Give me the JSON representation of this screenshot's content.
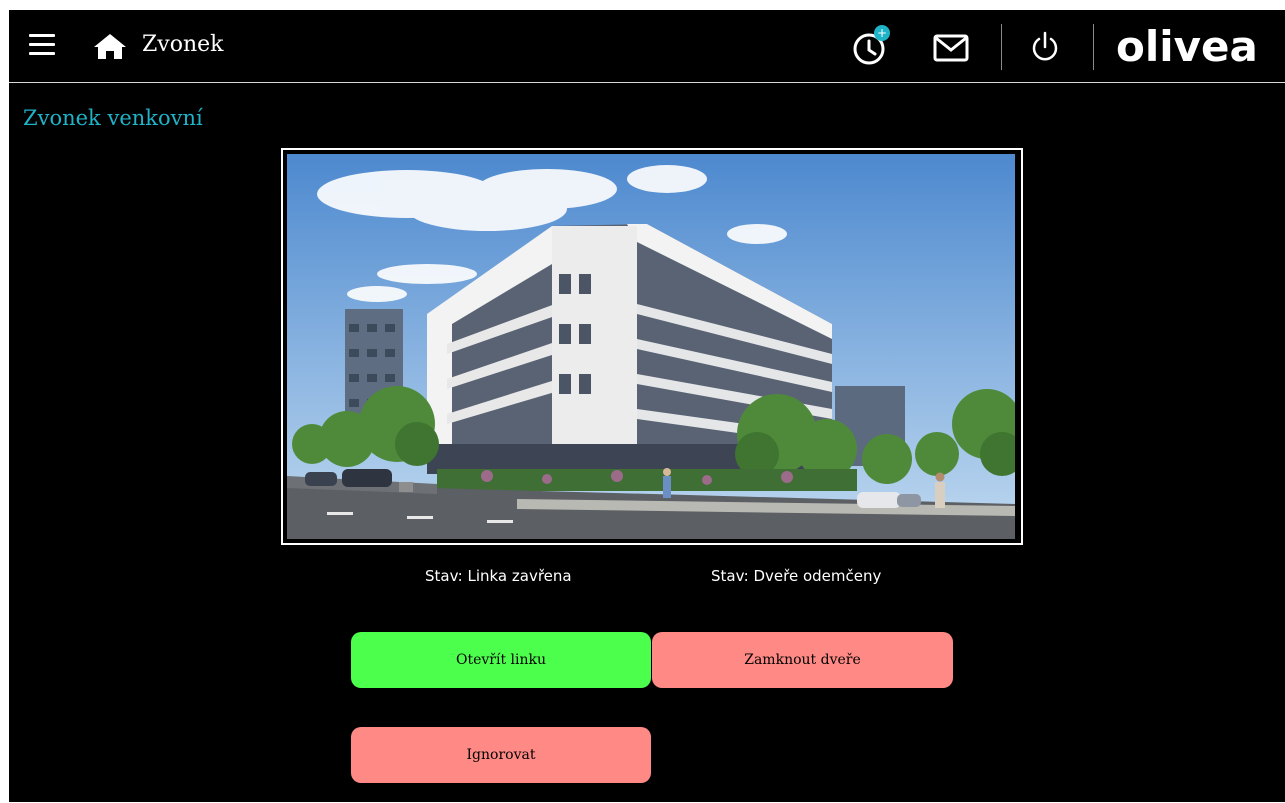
{
  "header": {
    "title": "Zvonek",
    "logo": "olivea",
    "icons": {
      "menu": "hamburger-menu-icon",
      "home": "home-icon",
      "timer": "timer-add-icon",
      "mail": "mail-icon",
      "power": "power-icon"
    },
    "timer_badge": "+"
  },
  "page": {
    "title": "Zvonek venkovní"
  },
  "camera": {
    "description": "camera-view"
  },
  "status": {
    "line": "Stav: Linka zavřena",
    "door": "Stav: Dveře odemčeny"
  },
  "buttons": {
    "open_line": "Otevřít linku",
    "lock_door": "Zamknout dveře",
    "ignore": "Ignorovat"
  },
  "colors": {
    "background": "#000000",
    "accent": "#1fb3c8",
    "open_line_button": "#4cff4c",
    "lock_door_button": "#ff8a85",
    "ignore_button": "#ff8a85",
    "badge": "#1fb3c8"
  }
}
